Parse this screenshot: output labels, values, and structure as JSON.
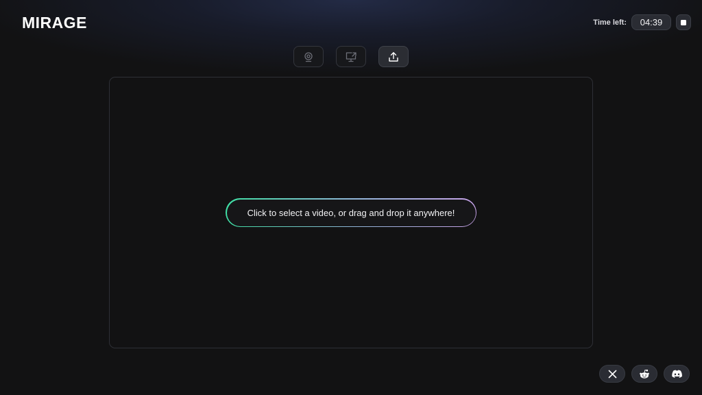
{
  "app": {
    "logo_text": "MIRAGE"
  },
  "timer": {
    "label": "Time left:",
    "value": "04:39",
    "stop_icon": "stop-icon"
  },
  "mode_buttons": [
    {
      "icon": "webcam-icon",
      "active": false
    },
    {
      "icon": "screen-share-icon",
      "active": false
    },
    {
      "icon": "upload-icon",
      "active": true
    }
  ],
  "dropzone": {
    "prompt": "Click to select a video, or drag and drop it anywhere!",
    "gradient_colors": [
      "#3fe0a5",
      "#8fb6d8",
      "#c7a2e8"
    ]
  },
  "social_links": [
    {
      "icon": "x-twitter-icon"
    },
    {
      "icon": "reddit-icon"
    },
    {
      "icon": "discord-icon"
    }
  ],
  "colors": {
    "background": "#121213",
    "button_bg": "#2a2c33",
    "text": "#ffffff"
  }
}
